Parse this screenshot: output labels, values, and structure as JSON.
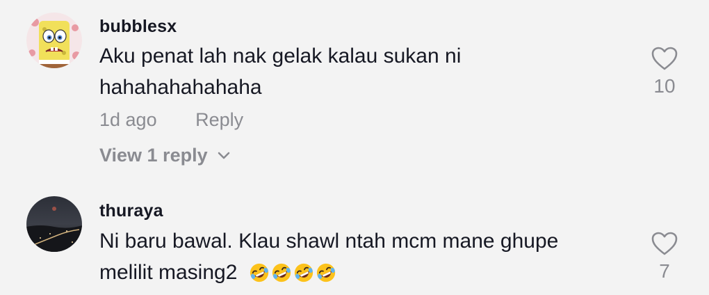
{
  "comments": [
    {
      "username": "bubblesx",
      "text_line1": "Aku penat lah nak gelak kalau sukan ni",
      "text_line2": "hahahahahahaha",
      "time": "1d ago",
      "reply_label": "Reply",
      "view_replies_label": "View 1 reply",
      "like_count": "10",
      "avatar_icon": "spongebob-avatar-icon"
    },
    {
      "username": "thuraya",
      "text_line1": "Ni baru bawal. Klau shawl ntah mcm mane ghupe",
      "text_line2": "melilit masing2",
      "emoji": "🤣🤣🤣🤣",
      "like_count": "7",
      "avatar_icon": "night-road-avatar-icon"
    }
  ],
  "colors": {
    "background": "#f3f3f3",
    "primary_text": "#161823",
    "secondary_text": "#8a8b91"
  }
}
